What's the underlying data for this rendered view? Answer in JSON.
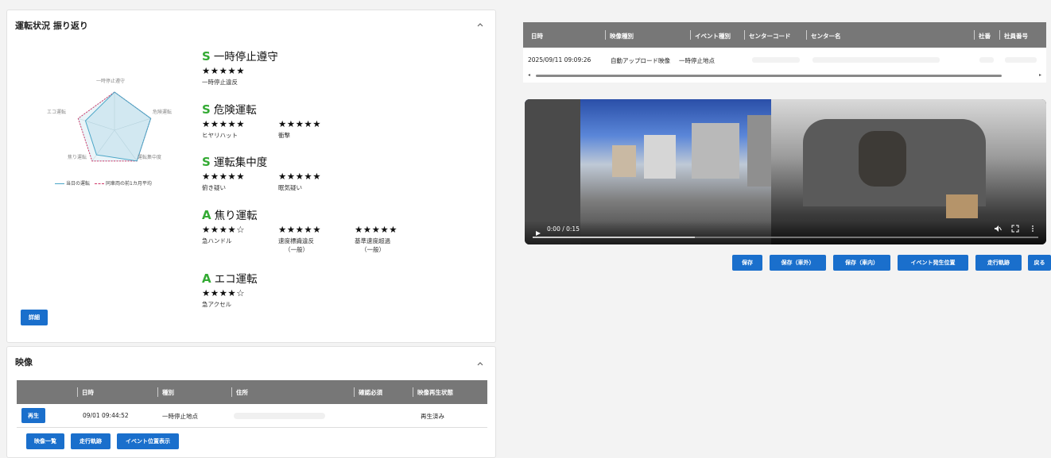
{
  "score_panel": {
    "title": "運転状況 振り返り",
    "detail_button": "詳細",
    "radar": {
      "axes": [
        "一時停止遵守",
        "危険運転",
        "運転集中度",
        "焦り運転",
        "エコ運転"
      ],
      "legend": [
        "当日の運転",
        "同車両の前1カ月平均"
      ],
      "today": [
        1.0,
        1.0,
        1.0,
        0.8,
        0.8
      ],
      "avg": [
        1.0,
        1.0,
        1.0,
        1.0,
        1.0
      ],
      "color_today": "#4aa6c7",
      "color_avg": "#d0386a"
    },
    "categories": [
      {
        "grade": "S",
        "name": "一時停止遵守",
        "items": [
          {
            "stars": "★★★★★",
            "label": "一時停止違反"
          }
        ]
      },
      {
        "grade": "S",
        "name": "危険運転",
        "items": [
          {
            "stars": "★★★★★",
            "label": "ヒヤリハット"
          },
          {
            "stars": "★★★★★",
            "label": "衝撃"
          }
        ]
      },
      {
        "grade": "S",
        "name": "運転集中度",
        "items": [
          {
            "stars": "★★★★★",
            "label": "俯き疑い"
          },
          {
            "stars": "★★★★★",
            "label": "眠気疑い"
          }
        ]
      },
      {
        "grade": "A",
        "name": "焦り運転",
        "items": [
          {
            "stars": "★★★★☆",
            "label": "急ハンドル"
          },
          {
            "stars": "★★★★★",
            "label": "速度標識違反",
            "sub": "（一般）"
          },
          {
            "stars": "★★★★★",
            "label": "基準速度超過",
            "sub": "（一般）"
          }
        ]
      },
      {
        "grade": "A",
        "name": "エコ運転",
        "items": [
          {
            "stars": "★★★★☆",
            "label": "急アクセル"
          }
        ]
      }
    ]
  },
  "video_panel": {
    "title": "映像",
    "headers": [
      "日時",
      "種別",
      "住所",
      "確認必須",
      "映像再生状態"
    ],
    "rows": [
      {
        "play": "再生",
        "datetime": "09/01 09:44:52",
        "type": "一時停止地点",
        "status": "再生済み"
      }
    ],
    "buttons": [
      "映像一覧",
      "走行軌跡",
      "イベント位置表示"
    ]
  },
  "event_table": {
    "headers": [
      "日時",
      "映像種別",
      "イベント種別",
      "センターコード",
      "センター名",
      "社番",
      "社員番号"
    ],
    "row": {
      "datetime": "2025/09/11 09:09:26",
      "video_type": "自動アップロード映像",
      "event_type": "一時停止地点"
    }
  },
  "player": {
    "time": "0:00 / 0:15",
    "progress": 0.32
  },
  "action_buttons": [
    "保存",
    "保存（車外）",
    "保存（車内）",
    "イベント発生位置",
    "走行軌跡",
    "戻る"
  ],
  "colors": {
    "button_blue": "#1a6fcc",
    "grade_green": "#33aa33",
    "table_header": "#777777"
  }
}
